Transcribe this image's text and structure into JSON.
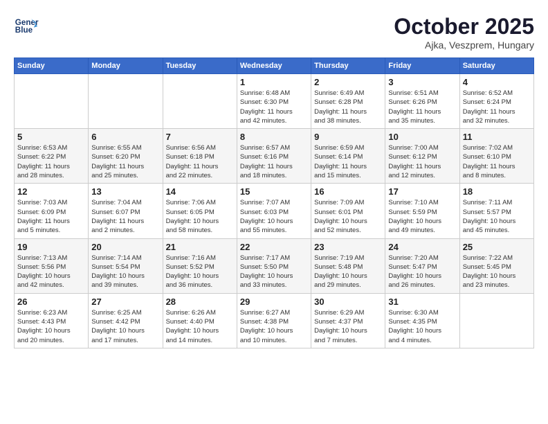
{
  "header": {
    "logo_line1": "General",
    "logo_line2": "Blue",
    "month": "October 2025",
    "location": "Ajka, Veszprem, Hungary"
  },
  "weekdays": [
    "Sunday",
    "Monday",
    "Tuesday",
    "Wednesday",
    "Thursday",
    "Friday",
    "Saturday"
  ],
  "weeks": [
    [
      {
        "day": "",
        "info": ""
      },
      {
        "day": "",
        "info": ""
      },
      {
        "day": "",
        "info": ""
      },
      {
        "day": "1",
        "info": "Sunrise: 6:48 AM\nSunset: 6:30 PM\nDaylight: 11 hours\nand 42 minutes."
      },
      {
        "day": "2",
        "info": "Sunrise: 6:49 AM\nSunset: 6:28 PM\nDaylight: 11 hours\nand 38 minutes."
      },
      {
        "day": "3",
        "info": "Sunrise: 6:51 AM\nSunset: 6:26 PM\nDaylight: 11 hours\nand 35 minutes."
      },
      {
        "day": "4",
        "info": "Sunrise: 6:52 AM\nSunset: 6:24 PM\nDaylight: 11 hours\nand 32 minutes."
      }
    ],
    [
      {
        "day": "5",
        "info": "Sunrise: 6:53 AM\nSunset: 6:22 PM\nDaylight: 11 hours\nand 28 minutes."
      },
      {
        "day": "6",
        "info": "Sunrise: 6:55 AM\nSunset: 6:20 PM\nDaylight: 11 hours\nand 25 minutes."
      },
      {
        "day": "7",
        "info": "Sunrise: 6:56 AM\nSunset: 6:18 PM\nDaylight: 11 hours\nand 22 minutes."
      },
      {
        "day": "8",
        "info": "Sunrise: 6:57 AM\nSunset: 6:16 PM\nDaylight: 11 hours\nand 18 minutes."
      },
      {
        "day": "9",
        "info": "Sunrise: 6:59 AM\nSunset: 6:14 PM\nDaylight: 11 hours\nand 15 minutes."
      },
      {
        "day": "10",
        "info": "Sunrise: 7:00 AM\nSunset: 6:12 PM\nDaylight: 11 hours\nand 12 minutes."
      },
      {
        "day": "11",
        "info": "Sunrise: 7:02 AM\nSunset: 6:10 PM\nDaylight: 11 hours\nand 8 minutes."
      }
    ],
    [
      {
        "day": "12",
        "info": "Sunrise: 7:03 AM\nSunset: 6:09 PM\nDaylight: 11 hours\nand 5 minutes."
      },
      {
        "day": "13",
        "info": "Sunrise: 7:04 AM\nSunset: 6:07 PM\nDaylight: 11 hours\nand 2 minutes."
      },
      {
        "day": "14",
        "info": "Sunrise: 7:06 AM\nSunset: 6:05 PM\nDaylight: 10 hours\nand 58 minutes."
      },
      {
        "day": "15",
        "info": "Sunrise: 7:07 AM\nSunset: 6:03 PM\nDaylight: 10 hours\nand 55 minutes."
      },
      {
        "day": "16",
        "info": "Sunrise: 7:09 AM\nSunset: 6:01 PM\nDaylight: 10 hours\nand 52 minutes."
      },
      {
        "day": "17",
        "info": "Sunrise: 7:10 AM\nSunset: 5:59 PM\nDaylight: 10 hours\nand 49 minutes."
      },
      {
        "day": "18",
        "info": "Sunrise: 7:11 AM\nSunset: 5:57 PM\nDaylight: 10 hours\nand 45 minutes."
      }
    ],
    [
      {
        "day": "19",
        "info": "Sunrise: 7:13 AM\nSunset: 5:56 PM\nDaylight: 10 hours\nand 42 minutes."
      },
      {
        "day": "20",
        "info": "Sunrise: 7:14 AM\nSunset: 5:54 PM\nDaylight: 10 hours\nand 39 minutes."
      },
      {
        "day": "21",
        "info": "Sunrise: 7:16 AM\nSunset: 5:52 PM\nDaylight: 10 hours\nand 36 minutes."
      },
      {
        "day": "22",
        "info": "Sunrise: 7:17 AM\nSunset: 5:50 PM\nDaylight: 10 hours\nand 33 minutes."
      },
      {
        "day": "23",
        "info": "Sunrise: 7:19 AM\nSunset: 5:48 PM\nDaylight: 10 hours\nand 29 minutes."
      },
      {
        "day": "24",
        "info": "Sunrise: 7:20 AM\nSunset: 5:47 PM\nDaylight: 10 hours\nand 26 minutes."
      },
      {
        "day": "25",
        "info": "Sunrise: 7:22 AM\nSunset: 5:45 PM\nDaylight: 10 hours\nand 23 minutes."
      }
    ],
    [
      {
        "day": "26",
        "info": "Sunrise: 6:23 AM\nSunset: 4:43 PM\nDaylight: 10 hours\nand 20 minutes."
      },
      {
        "day": "27",
        "info": "Sunrise: 6:25 AM\nSunset: 4:42 PM\nDaylight: 10 hours\nand 17 minutes."
      },
      {
        "day": "28",
        "info": "Sunrise: 6:26 AM\nSunset: 4:40 PM\nDaylight: 10 hours\nand 14 minutes."
      },
      {
        "day": "29",
        "info": "Sunrise: 6:27 AM\nSunset: 4:38 PM\nDaylight: 10 hours\nand 10 minutes."
      },
      {
        "day": "30",
        "info": "Sunrise: 6:29 AM\nSunset: 4:37 PM\nDaylight: 10 hours\nand 7 minutes."
      },
      {
        "day": "31",
        "info": "Sunrise: 6:30 AM\nSunset: 4:35 PM\nDaylight: 10 hours\nand 4 minutes."
      },
      {
        "day": "",
        "info": ""
      }
    ]
  ]
}
